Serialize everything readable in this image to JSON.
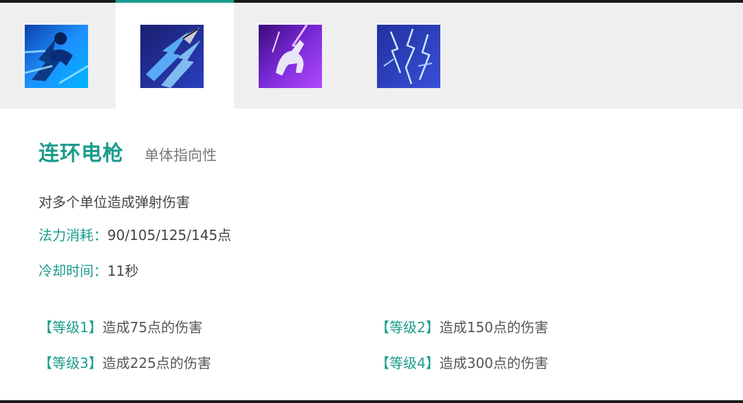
{
  "tabs": [
    {
      "icon": "sprint-icon",
      "active": false
    },
    {
      "icon": "chain-spear-icon",
      "active": true
    },
    {
      "icon": "lightning-horse-icon",
      "active": false
    },
    {
      "icon": "lightning-storm-icon",
      "active": false
    }
  ],
  "skill": {
    "name": "连环电枪",
    "type": "单体指向性",
    "description": "对多个单位造成弹射伤害",
    "mana_label": "法力消耗：",
    "mana_value": "90/105/125/145点",
    "cooldown_label": "冷却时间：",
    "cooldown_value": "11秒"
  },
  "levels": [
    {
      "tag": "【等级1】",
      "text": "造成75点的伤害"
    },
    {
      "tag": "【等级2】",
      "text": "造成150点的伤害"
    },
    {
      "tag": "【等级3】",
      "text": "造成225点的伤害"
    },
    {
      "tag": "【等级4】",
      "text": "造成300点的伤害"
    }
  ],
  "colors": {
    "accent": "#1a9c8c",
    "tabbar_bg": "#efefef",
    "text_main": "#444444",
    "text_muted": "#777777"
  }
}
